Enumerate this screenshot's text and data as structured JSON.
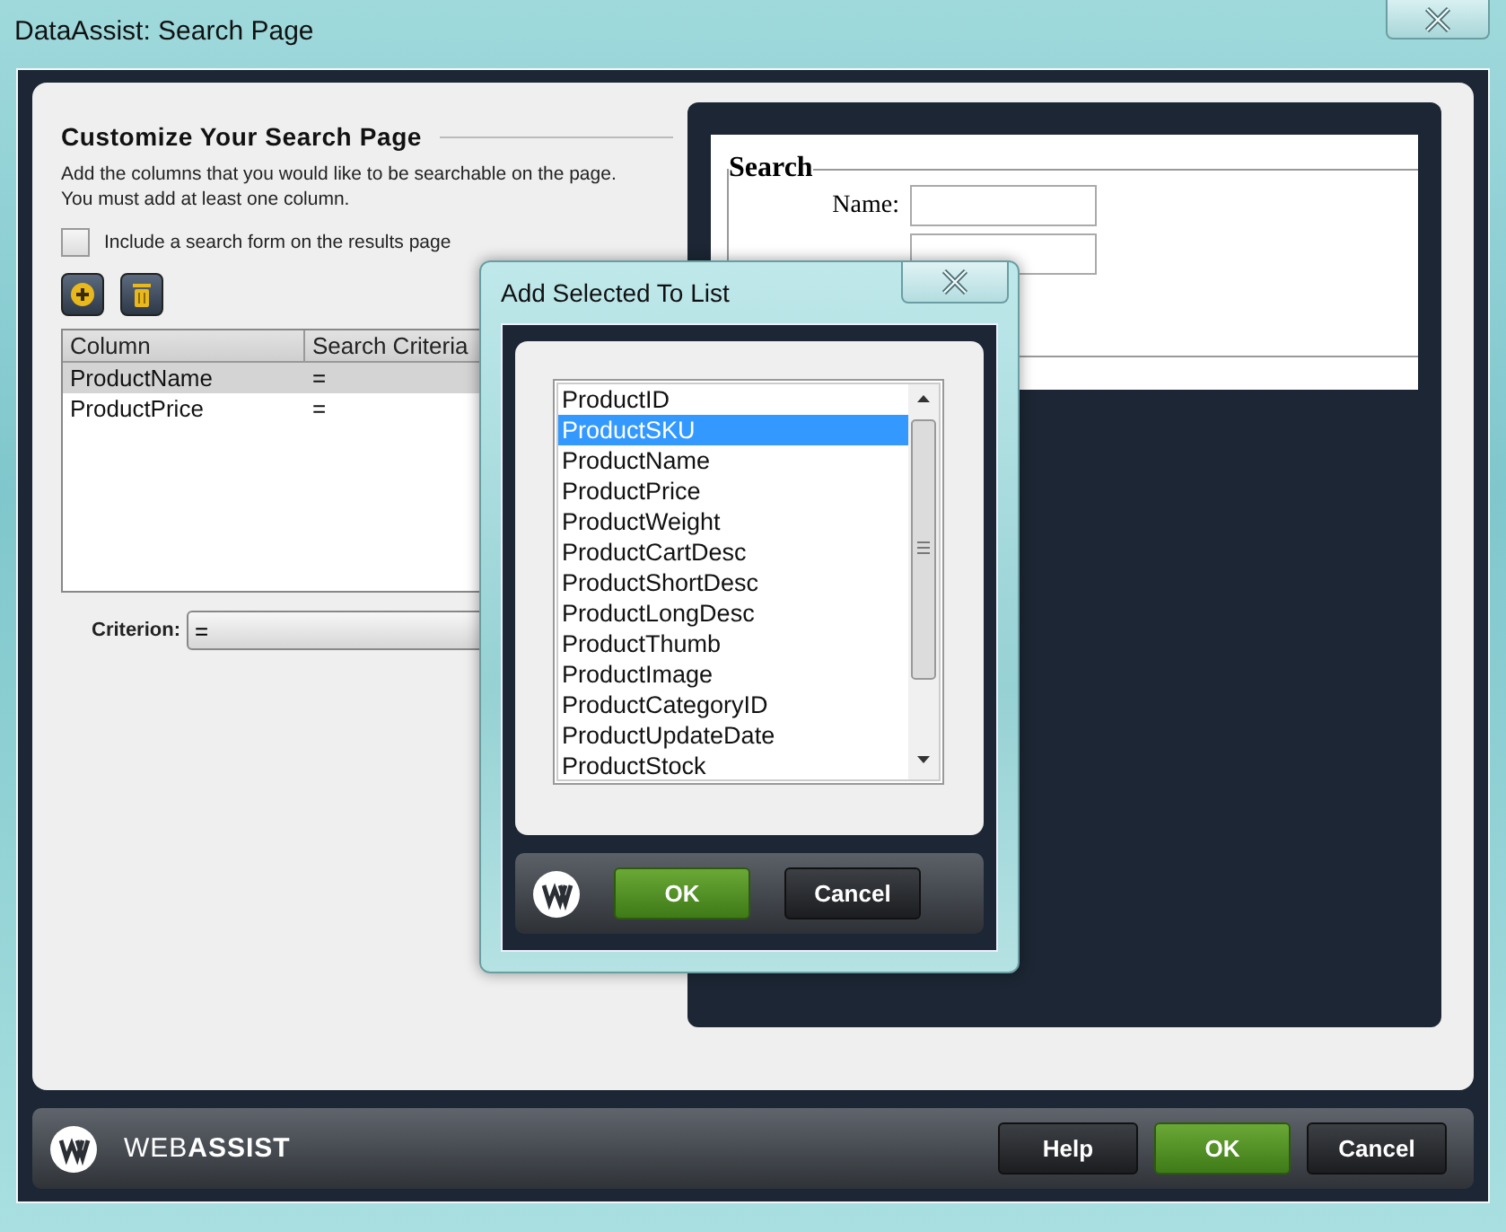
{
  "window": {
    "title": "DataAssist: Search Page"
  },
  "section": {
    "heading": "Customize Your Search Page",
    "description": "Add the columns that you would like to be searchable on the page.\nYou must add at least one column."
  },
  "include_search_form": {
    "label": "Include a search form on the results page",
    "checked": false
  },
  "table": {
    "columns": [
      "Column",
      "Search Criteria"
    ],
    "rows": [
      {
        "cells": [
          "ProductName",
          "="
        ],
        "selected": true
      },
      {
        "cells": [
          "ProductPrice",
          "="
        ],
        "selected": false
      }
    ]
  },
  "criterion": {
    "label": "Criterion:",
    "value": "="
  },
  "preview": {
    "legend": "Search",
    "fields": [
      {
        "kind": "labeled",
        "label": "Name:"
      },
      {
        "kind": "unlabeled"
      }
    ]
  },
  "dialog": {
    "title": "Add Selected To List",
    "items": [
      {
        "label": "ProductID",
        "selected": false
      },
      {
        "label": "ProductSKU",
        "selected": true
      },
      {
        "label": "ProductName",
        "selected": false
      },
      {
        "label": "ProductPrice",
        "selected": false
      },
      {
        "label": "ProductWeight",
        "selected": false
      },
      {
        "label": "ProductCartDesc",
        "selected": false
      },
      {
        "label": "ProductShortDesc",
        "selected": false
      },
      {
        "label": "ProductLongDesc",
        "selected": false
      },
      {
        "label": "ProductThumb",
        "selected": false
      },
      {
        "label": "ProductImage",
        "selected": false
      },
      {
        "label": "ProductCategoryID",
        "selected": false
      },
      {
        "label": "ProductUpdateDate",
        "selected": false
      },
      {
        "label": "ProductStock",
        "selected": false
      }
    ],
    "buttons": [
      {
        "label": "OK",
        "kind": "primary"
      },
      {
        "label": "Cancel",
        "kind": "secondary"
      }
    ]
  },
  "footer": {
    "brand": "WEB**ASSIST**",
    "buttons": [
      {
        "label": "Help",
        "kind": "secondary"
      },
      {
        "label": "OK",
        "kind": "primary"
      },
      {
        "label": "Cancel",
        "kind": "secondary"
      }
    ]
  }
}
